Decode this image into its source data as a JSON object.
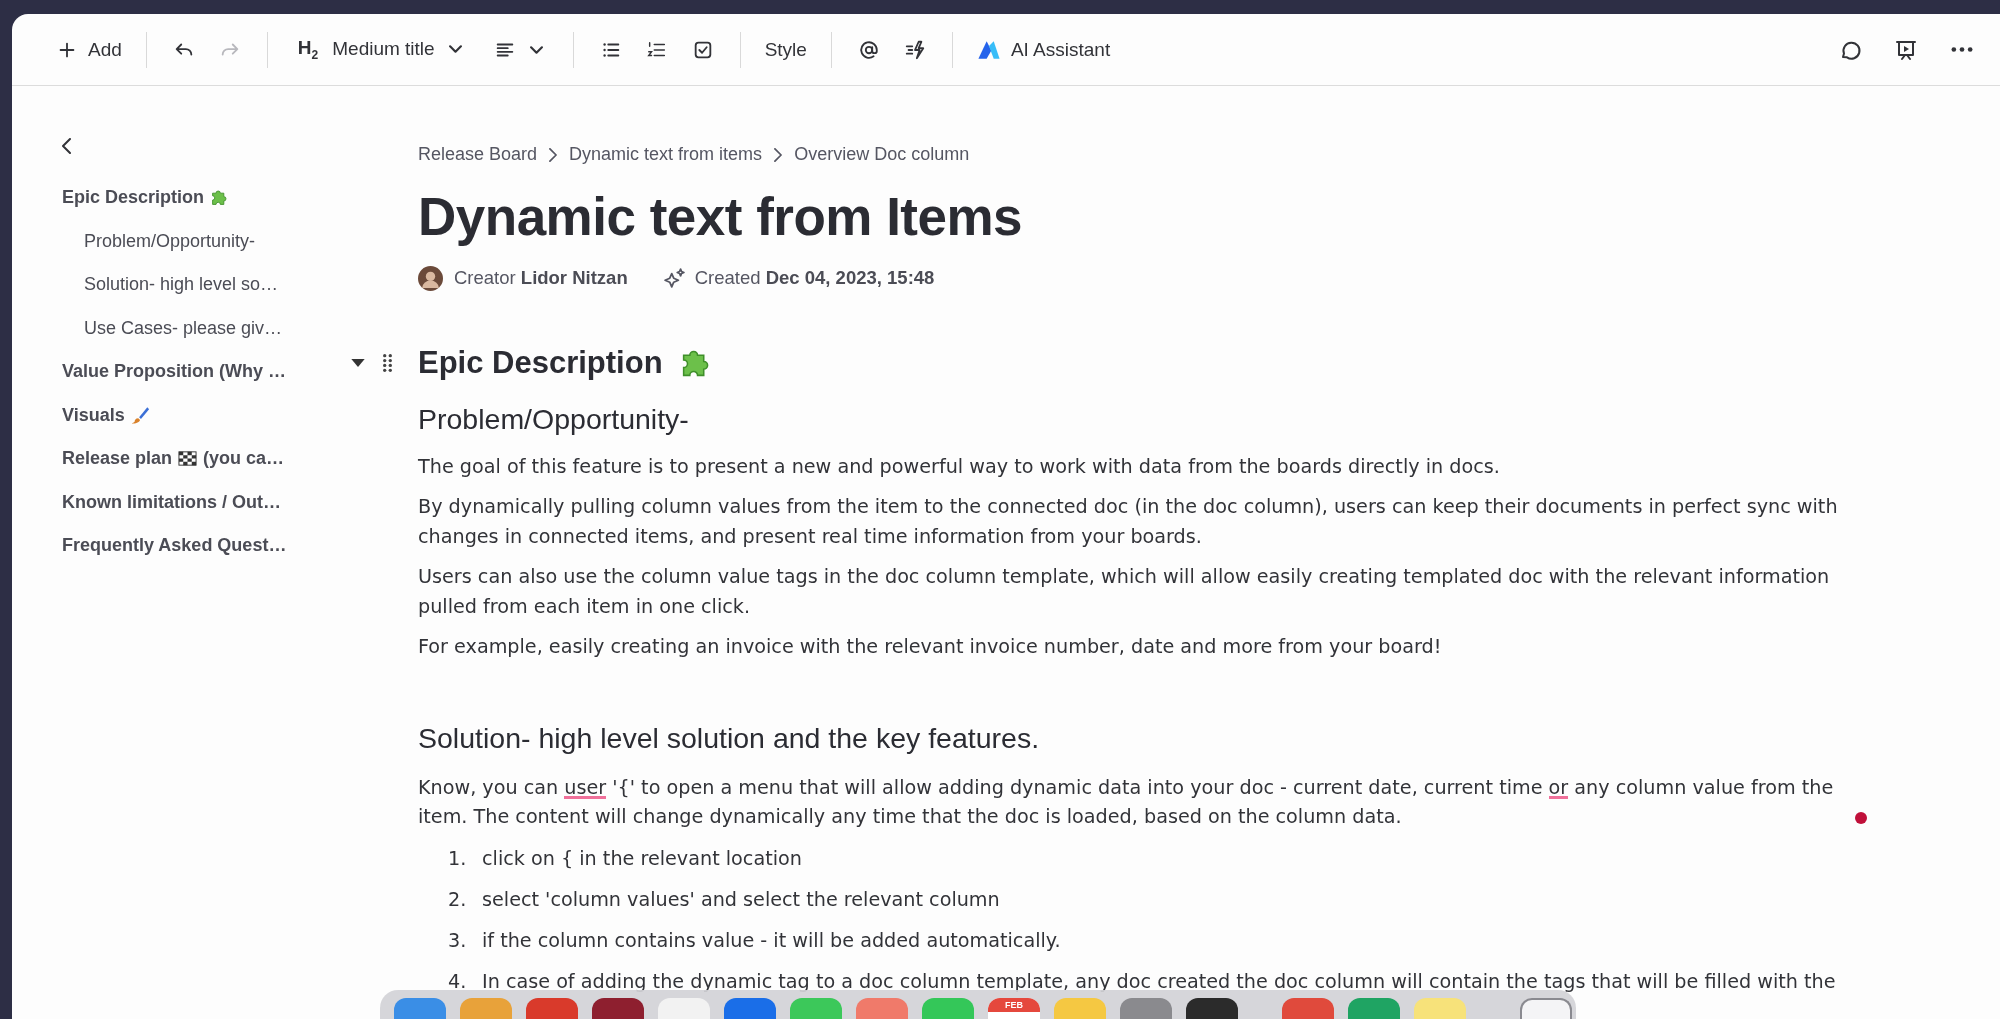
{
  "toolbar": {
    "items": [
      {
        "kind": "text-button",
        "label": "Add"
      },
      {
        "kind": "divider"
      },
      {
        "kind": "icon-button",
        "disabled": false
      },
      {
        "kind": "icon-button",
        "disabled": true
      },
      {
        "kind": "divider"
      },
      {
        "kind": "dropdown",
        "prefix": "H$_{2}$",
        "label": "Medium title"
      },
      {
        "kind": "icon-dropdown"
      },
      {
        "kind": "divider"
      },
      {
        "kind": "icon-button",
        "disabled": false
      },
      {
        "kind": "icon-button",
        "disabled": false
      },
      {
        "kind": "icon-button",
        "disabled": false
      },
      {
        "kind": "divider"
      },
      {
        "kind": "text-button",
        "label": "Style"
      },
      {
        "kind": "divider"
      },
      {
        "kind": "icon-button",
        "disabled": false
      },
      {
        "kind": "icon-button",
        "disabled": false
      },
      {
        "kind": "divider"
      },
      {
        "kind": "text-button",
        "label": "AI Assistant"
      }
    ]
  },
  "sidebar": {
    "items": [
      {
        "label": "Epic Description",
        "children": [
          {
            "label": "Problem/Opportunity-"
          },
          {
            "label": "Solution- high level so…"
          },
          {
            "label": "Use Cases- please giv…"
          }
        ]
      },
      {
        "label": "Value Proposition (Why …"
      },
      {
        "label": "Visuals"
      },
      {
        "label": "Release plan",
        "label_after": "(you ca…"
      },
      {
        "label": "Known limitations / Out…"
      },
      {
        "label": "Frequently Asked Quest…"
      }
    ]
  },
  "breadcrumb": [
    "Release Board",
    "Dynamic text from items",
    "Overview Doc column"
  ],
  "title": "Dynamic text from Items",
  "meta": {
    "creator_label": "Creator",
    "creator": "Lidor Nitzan",
    "created_label": "Created",
    "created": "Dec 04, 2023, 15:48"
  },
  "blocks": [
    {
      "kind": "heading1",
      "text": "Epic Description",
      "expanded": true
    },
    {
      "kind": "heading2",
      "text": "Problem/Opportunity-"
    },
    {
      "kind": "paragraph",
      "runs": [
        {
          "text": "The goal of this feature is to present a new and powerful way to work with data from the boards directly in docs.",
          "misspelled": false
        }
      ]
    },
    {
      "kind": "paragraph",
      "runs": [
        {
          "text": "By dynamically pulling column values from the item to the connected doc (in the doc column),  users can keep their documents in perfect sync with changes in connected items, and present real time information from your boards.",
          "misspelled": false
        }
      ]
    },
    {
      "kind": "paragraph",
      "runs": [
        {
          "text": "Users can also use the column value tags in the doc column template, which will allow easily creating templated doc with the relevant information pulled from each item in one click.",
          "misspelled": false
        }
      ]
    },
    {
      "kind": "paragraph",
      "runs": [
        {
          "text": "For example, easily creating an invoice with the relevant invoice number, date and more from your board!",
          "misspelled": false
        }
      ]
    },
    {
      "kind": "heading2",
      "text": "Solution- high level solution and the key features."
    },
    {
      "kind": "paragraph",
      "runs": [
        {
          "text": "Know, you can ",
          "misspelled": false
        },
        {
          "text": "user",
          "misspelled": true
        },
        {
          "text": " '{' to open a menu that will allow adding dynamic data into your doc - current date, current time ",
          "misspelled": false
        },
        {
          "text": "or",
          "misspelled": true
        },
        {
          "text": " any column value from the item. The content will change dynamically any time that the doc is loaded, based on the column data.",
          "misspelled": false
        }
      ]
    },
    {
      "kind": "numbered-list",
      "items": [
        {
          "number": "1.",
          "text": "click on { in the relevant location"
        },
        {
          "number": "2.",
          "text": "select 'column values' and select the relevant column"
        },
        {
          "number": "3.",
          "text": "if the column contains value - it will be added automatically."
        },
        {
          "number": "4.",
          "text": "In case of adding the dynamic tag to a doc column template, any doc created the doc column will contain the tags that will be filled with the"
        }
      ]
    }
  ],
  "dock": {
    "apps": [
      {
        "kind": "app",
        "color": "#3a8ee6"
      },
      {
        "kind": "app",
        "color": "#e8a23a"
      },
      {
        "kind": "app",
        "color": "#d93a2b"
      },
      {
        "kind": "app",
        "color": "#8e1f2f"
      },
      {
        "kind": "app",
        "color": "#f2f2f2"
      },
      {
        "kind": "app",
        "color": "#1a6ee8"
      },
      {
        "kind": "app",
        "color": "#3cc85a"
      },
      {
        "kind": "app",
        "color": "#f07a6a"
      },
      {
        "kind": "app",
        "color": "#34c759"
      },
      {
        "kind": "calendar",
        "color": "#e5483d",
        "label": "FEB"
      },
      {
        "kind": "app",
        "color": "#f5c842"
      },
      {
        "kind": "app",
        "color": "#8a8a8e"
      },
      {
        "kind": "app",
        "color": "#2b2b2b"
      },
      {
        "kind": "separator"
      },
      {
        "kind": "app",
        "color": "#e04a3c"
      },
      {
        "kind": "app",
        "color": "#1fa463"
      },
      {
        "kind": "app",
        "color": "#f7e27a"
      },
      {
        "kind": "trash",
        "color": "#f4f4f6"
      }
    ]
  }
}
